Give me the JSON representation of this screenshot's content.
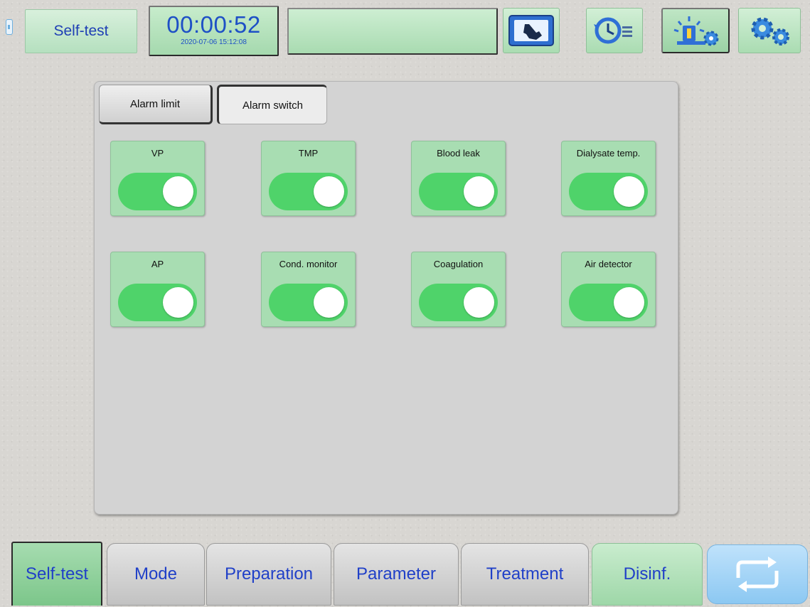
{
  "header": {
    "mode_title": "Self-test",
    "clock": {
      "time": "00:00:52",
      "date": "2020-07-06 15:12:08"
    },
    "message": "",
    "icons": [
      {
        "name": "hand-touch-icon"
      },
      {
        "name": "history-list-icon"
      },
      {
        "name": "lamp-settings-icon"
      },
      {
        "name": "gears-icon"
      }
    ]
  },
  "tabs": {
    "limit_label": "Alarm limit",
    "switch_label": "Alarm switch",
    "selected": "Alarm switch"
  },
  "switches": [
    {
      "label": "VP",
      "on": true
    },
    {
      "label": "TMP",
      "on": true
    },
    {
      "label": "Blood leak",
      "on": true
    },
    {
      "label": "Dialysate temp.",
      "on": true
    },
    {
      "label": "AP",
      "on": true
    },
    {
      "label": "Cond. monitor",
      "on": true
    },
    {
      "label": "Coagulation",
      "on": true
    },
    {
      "label": "Air detector",
      "on": true
    }
  ],
  "nav": {
    "items": [
      "Self-test",
      "Mode",
      "Preparation",
      "Parameter",
      "Treatment",
      "Disinf."
    ],
    "active": "Self-test",
    "cycle_icon": "cycle-arrows-icon"
  },
  "colors": {
    "toggle_on": "#4fd36a",
    "card_bg": "#a8ddb2",
    "text_blue": "#2040c8"
  }
}
